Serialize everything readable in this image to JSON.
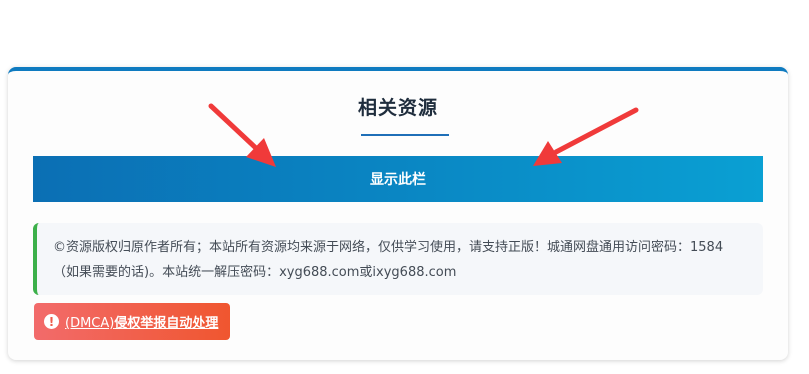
{
  "section": {
    "title": "相关资源",
    "show_button_label": "显示此栏"
  },
  "notice": {
    "text": "©资源版权归原作者所有；本站所有资源均来源于网络，仅供学习使用，请支持正版！城通网盘通用访问密码：1584（如果需要的话)。本站统一解压密码：xyg688.com或ixyg688.com"
  },
  "dmca": {
    "prefix": "(DMCA)",
    "label": "侵权举报自动处理",
    "icon": "exclamation-circle-icon"
  },
  "colors": {
    "accent": "#0f7bc0",
    "button_start": "#0b6fb4",
    "button_end": "#0aa0d3",
    "notice_border": "#3cb04a",
    "dmca_start": "#f26b6b",
    "dmca_end": "#f0562f",
    "arrow": "#f03a3a"
  }
}
